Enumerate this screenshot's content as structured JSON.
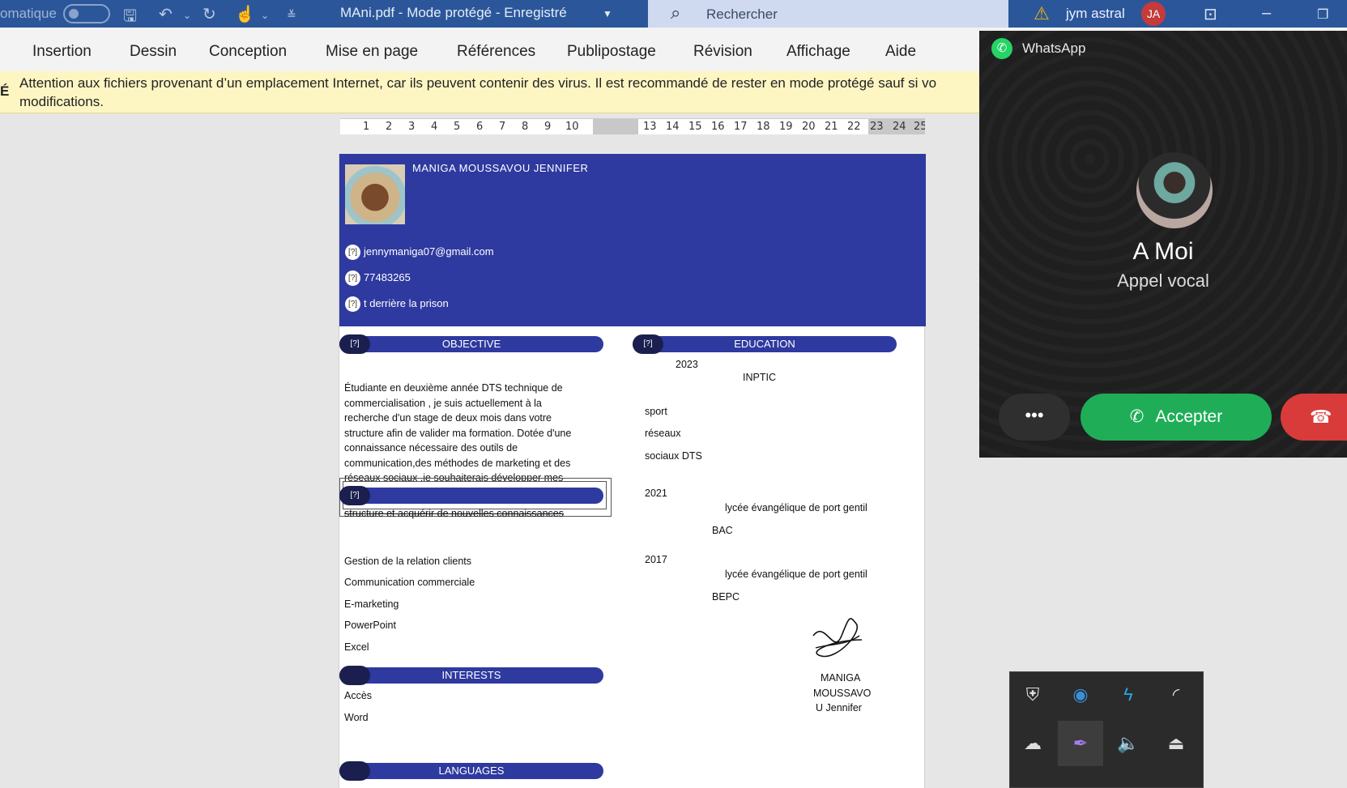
{
  "titlebar": {
    "autosave": "omatique",
    "doc_title": "MAni.pdf  -  Mode protégé  -  Enregistré",
    "search_placeholder": "Rechercher",
    "user_name": "jym astral",
    "user_initials": "JA"
  },
  "ribbon": {
    "tabs": [
      "Insertion",
      "Dessin",
      "Conception",
      "Mise en page",
      "Références",
      "Publipostage",
      "Révision",
      "Affichage",
      "Aide"
    ]
  },
  "protected_bar": {
    "marker": "É",
    "line1": "Attention aux fichiers provenant d’un emplacement Internet, car ils peuvent contenir des virus. Il est recommandé de rester en mode protégé sauf si vo",
    "line2": "modifications."
  },
  "ruler": {
    "marks": [
      "1",
      "2",
      "3",
      "4",
      "5",
      "6",
      "7",
      "8",
      "9",
      "10",
      "13",
      "14",
      "15",
      "16",
      "17",
      "18",
      "19",
      "20",
      "21",
      "22",
      "23",
      "24",
      "25"
    ]
  },
  "cv": {
    "name": "MANIGA  MOUSSAVOU  JENNIFER",
    "email": "jennymaniga07@gmail.com",
    "phone": "77483265",
    "address": "t derrière  la prison",
    "contact_icon": "[?]",
    "sections": {
      "objective": "OBJECTIVE",
      "education": "EDUCATION",
      "interests": "INTERESTS",
      "languages": "LANGUAGES"
    },
    "objective_text": "Étudiante en deuxième année DTS technique de commercialisation , je suis actuellement à la recherche d'un stage de deux mois dans votre structure afin de valider ma formation. Dotée d'une connaissance nécessaire des outils de communication,des méthodes de marketing et des réseaux sociaux ,je souhaiterais développer mes compétences au sein de votre",
    "objective_overflow": "structure et acquérir de nouvelles connaissances",
    "skills": [
      "Gestion de la relation clients",
      "Communication commerciale",
      "E-marketing",
      "PowerPoint",
      "Excel"
    ],
    "interests": [
      "Accès",
      "Word"
    ],
    "education": {
      "year1": "2023",
      "school1": "INPTIC",
      "items1": [
        "sport",
        "réseaux",
        "sociaux DTS"
      ],
      "year2": "2021",
      "school2": "lycée évangélique de port gentil",
      "diploma2": "BAC",
      "year3": "2017",
      "school3": "lycée évangélique de port gentil",
      "diploma3": "BEPC"
    },
    "signature_name": [
      "MANIGA",
      "MOUSSAVO",
      "U Jennifer"
    ]
  },
  "whatsapp": {
    "app_name": "WhatsApp",
    "caller": "A Moi",
    "call_type": "Appel vocal",
    "more": "•••",
    "accept": "Accepter",
    "accept_color": "#1fae57",
    "decline_color": "#d93b3b"
  },
  "tray": {
    "icons": [
      "shield-warning-icon",
      "network-utility-icon",
      "lightning-icon",
      "wifi-icon",
      "onedrive-off-icon",
      "feather-pen-icon",
      "volume-icon",
      "safely-remove-icon"
    ]
  }
}
